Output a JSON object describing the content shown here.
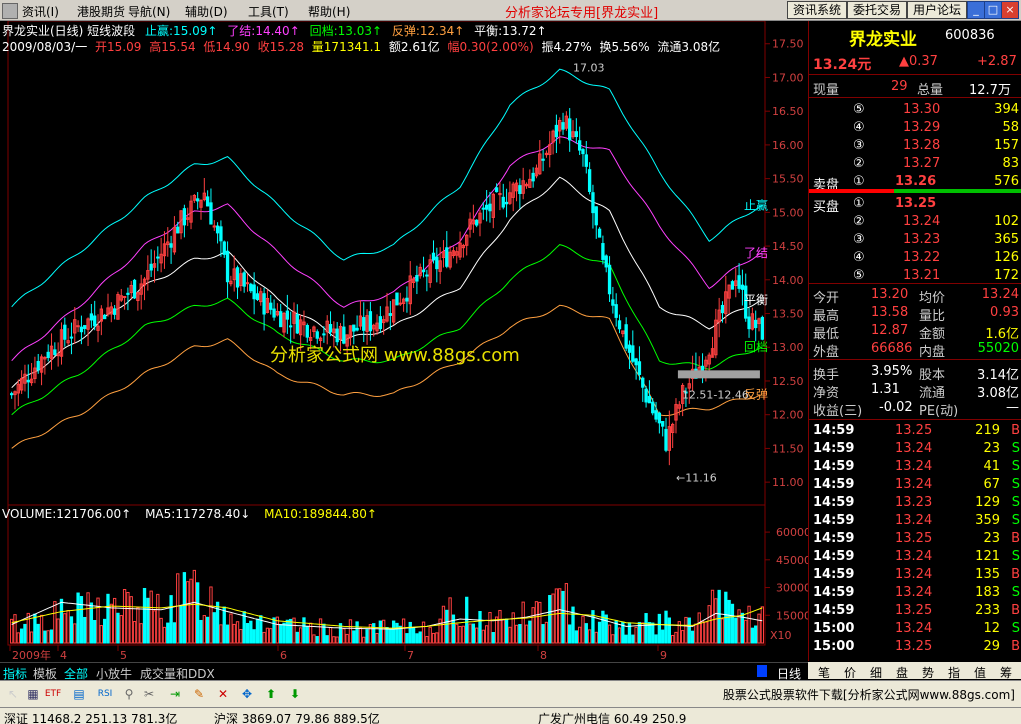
{
  "menubar": {
    "items": [
      "资讯(I)",
      "港股期货",
      "导航(N)",
      "辅助(D)",
      "工具(T)",
      "帮助(H)"
    ],
    "center_title": "分析家论坛专用[界龙实业]",
    "buttons": [
      "资讯系统",
      "委托交易",
      "用户论坛"
    ],
    "window_buttons": [
      "_",
      "□",
      "×"
    ]
  },
  "chart_header": {
    "line1": [
      {
        "text": "界龙实业(日线) 短线波段",
        "color": "#ffffff"
      },
      {
        "text": "止赢:15.09↑",
        "color": "#00ffff"
      },
      {
        "text": "了结:14.40↑",
        "color": "#ff40ff"
      },
      {
        "text": "回档:13.03↑",
        "color": "#00ff00"
      },
      {
        "text": "反弹:12.34↑",
        "color": "#ffa040"
      },
      {
        "text": "平衡:13.72↑",
        "color": "#ffffff"
      }
    ],
    "line2": [
      {
        "text": "2009/08/03/一",
        "color": "#ffffff"
      },
      {
        "text": "开15.09",
        "color": "#ff4040"
      },
      {
        "text": "高15.54",
        "color": "#ff4040"
      },
      {
        "text": "低14.90",
        "color": "#ff4040"
      },
      {
        "text": "收15.28",
        "color": "#ff4040"
      },
      {
        "text": "量171341.1",
        "color": "#ffff00"
      },
      {
        "text": "额2.61亿",
        "color": "#ffffff"
      },
      {
        "text": "幅0.30(2.00%)",
        "color": "#ff4040"
      },
      {
        "text": "振4.27%",
        "color": "#ffffff"
      },
      {
        "text": "换5.56%",
        "color": "#ffffff"
      },
      {
        "text": "流通3.08亿",
        "color": "#ffffff"
      }
    ],
    "watermark": "分析家公式网 www.88gs.com"
  },
  "chart_data": [
    {
      "type": "line",
      "name": "price-chart",
      "yaxis_ticks": [
        17.5,
        17.0,
        16.5,
        16.0,
        15.5,
        15.0,
        14.5,
        14.0,
        13.5,
        13.0,
        12.5,
        12.0,
        11.5,
        11.0
      ],
      "ylim": [
        10.75,
        17.6
      ],
      "x_ticks": [
        "2009年",
        "4",
        "5",
        "6",
        "7",
        "8",
        "9"
      ],
      "annotations": [
        {
          "text": "17.03",
          "x_index": 166,
          "y": 17.03
        },
        {
          "text": "11.16",
          "x_index": 197,
          "y": 11.16
        },
        {
          "text": "12.51-12.46",
          "x_index": 206,
          "y": 12.45
        }
      ],
      "band_labels": [
        "止赢",
        "了结",
        "平衡",
        "回档",
        "反弹"
      ],
      "series": [
        {
          "name": "止赢",
          "color": "#00ffff",
          "key": [
            [
              0,
              13.6
            ],
            [
              20,
              14.4
            ],
            [
              40,
              15.2
            ],
            [
              55,
              15.7
            ],
            [
              65,
              15.8
            ],
            [
              80,
              15.1
            ],
            [
              100,
              14.3
            ],
            [
              115,
              14.5
            ],
            [
              135,
              15.4
            ],
            [
              150,
              16.6
            ],
            [
              165,
              17.1
            ],
            [
              180,
              16.8
            ],
            [
              195,
              15.6
            ],
            [
              210,
              14.6
            ],
            [
              225,
              15.1
            ]
          ]
        },
        {
          "name": "了结",
          "color": "#ff40ff",
          "key": [
            [
              0,
              12.8
            ],
            [
              20,
              13.6
            ],
            [
              40,
              14.5
            ],
            [
              55,
              15.0
            ],
            [
              65,
              15.1
            ],
            [
              80,
              14.4
            ],
            [
              100,
              13.6
            ],
            [
              115,
              13.8
            ],
            [
              135,
              14.6
            ],
            [
              150,
              15.7
            ],
            [
              165,
              16.1
            ],
            [
              180,
              15.9
            ],
            [
              195,
              14.8
            ],
            [
              210,
              13.9
            ],
            [
              225,
              14.4
            ]
          ]
        },
        {
          "name": "平衡",
          "color": "#ffffff",
          "key": [
            [
              0,
              12.4
            ],
            [
              20,
              13.1
            ],
            [
              40,
              13.9
            ],
            [
              55,
              14.3
            ],
            [
              65,
              14.4
            ],
            [
              80,
              13.7
            ],
            [
              100,
              13.1
            ],
            [
              115,
              13.3
            ],
            [
              135,
              13.9
            ],
            [
              150,
              14.9
            ],
            [
              165,
              15.5
            ],
            [
              180,
              15.0
            ],
            [
              195,
              13.6
            ],
            [
              210,
              13.3
            ],
            [
              225,
              13.7
            ]
          ]
        },
        {
          "name": "回档",
          "color": "#00ff00",
          "key": [
            [
              0,
              12.0
            ],
            [
              20,
              12.6
            ],
            [
              40,
              13.3
            ],
            [
              55,
              13.6
            ],
            [
              65,
              13.7
            ],
            [
              80,
              13.2
            ],
            [
              100,
              12.8
            ],
            [
              115,
              12.8
            ],
            [
              135,
              13.3
            ],
            [
              150,
              14.0
            ],
            [
              165,
              14.5
            ],
            [
              180,
              14.2
            ],
            [
              195,
              12.8
            ],
            [
              210,
              12.7
            ],
            [
              225,
              13.0
            ]
          ]
        },
        {
          "name": "反弹",
          "color": "#ffa040",
          "key": [
            [
              0,
              11.5
            ],
            [
              20,
              12.0
            ],
            [
              40,
              12.6
            ],
            [
              55,
              13.0
            ],
            [
              65,
              13.1
            ],
            [
              80,
              12.6
            ],
            [
              100,
              12.3
            ],
            [
              115,
              12.3
            ],
            [
              135,
              12.8
            ],
            [
              150,
              13.3
            ],
            [
              165,
              13.6
            ],
            [
              180,
              13.4
            ],
            [
              195,
              12.0
            ],
            [
              210,
              12.1
            ],
            [
              225,
              12.3
            ]
          ]
        }
      ],
      "candle_key": [
        [
          0,
          12.3
        ],
        [
          10,
          12.9
        ],
        [
          20,
          13.3
        ],
        [
          30,
          13.6
        ],
        [
          40,
          14.0
        ],
        [
          50,
          14.8
        ],
        [
          58,
          15.3
        ],
        [
          65,
          14.1
        ],
        [
          72,
          13.8
        ],
        [
          80,
          13.5
        ],
        [
          90,
          13.3
        ],
        [
          100,
          13.2
        ],
        [
          110,
          13.4
        ],
        [
          120,
          13.9
        ],
        [
          130,
          14.3
        ],
        [
          140,
          14.9
        ],
        [
          150,
          15.3
        ],
        [
          158,
          15.6
        ],
        [
          166,
          16.4
        ],
        [
          172,
          15.8
        ],
        [
          178,
          14.2
        ],
        [
          184,
          13.2
        ],
        [
          190,
          12.4
        ],
        [
          197,
          11.6
        ],
        [
          202,
          12.3
        ],
        [
          208,
          12.8
        ],
        [
          214,
          13.5
        ],
        [
          218,
          14.1
        ],
        [
          222,
          13.4
        ],
        [
          226,
          13.24
        ]
      ],
      "candle_count": 227
    },
    {
      "type": "bar",
      "name": "volume-chart",
      "header": [
        {
          "text": "VOLUME:121706.00↑",
          "color": "#ffffff"
        },
        {
          "text": "MA5:117278.40↓",
          "color": "#ffffff"
        },
        {
          "text": "MA10:189844.80↑",
          "color": "#ffff00"
        }
      ],
      "yaxis_ticks": [
        60000,
        45000,
        30000,
        15000
      ],
      "ylim": [
        0,
        66000
      ],
      "unit_label": "X10",
      "vol_key": [
        [
          0,
          9000
        ],
        [
          15,
          14000
        ],
        [
          30,
          18000
        ],
        [
          45,
          17000
        ],
        [
          55,
          25000
        ],
        [
          65,
          16000
        ],
        [
          80,
          8000
        ],
        [
          100,
          7000
        ],
        [
          115,
          7000
        ],
        [
          125,
          8000
        ],
        [
          135,
          16000
        ],
        [
          145,
          11000
        ],
        [
          155,
          13000
        ],
        [
          165,
          20000
        ],
        [
          175,
          12000
        ],
        [
          185,
          8000
        ],
        [
          195,
          10000
        ],
        [
          205,
          8000
        ],
        [
          212,
          18000
        ],
        [
          220,
          14000
        ],
        [
          226,
          12000
        ]
      ],
      "ma5_key": [
        [
          0,
          10000
        ],
        [
          15,
          22000
        ],
        [
          30,
          19000
        ],
        [
          45,
          18000
        ],
        [
          55,
          22000
        ],
        [
          65,
          17000
        ],
        [
          80,
          10000
        ],
        [
          100,
          8000
        ],
        [
          115,
          7500
        ],
        [
          125,
          9000
        ],
        [
          135,
          13000
        ],
        [
          145,
          12000
        ],
        [
          155,
          14000
        ],
        [
          165,
          18000
        ],
        [
          175,
          14000
        ],
        [
          185,
          9000
        ],
        [
          195,
          10000
        ],
        [
          205,
          9000
        ],
        [
          212,
          16000
        ],
        [
          220,
          14000
        ],
        [
          226,
          12000
        ]
      ],
      "ma10_key": [
        [
          0,
          11000
        ],
        [
          15,
          17000
        ],
        [
          30,
          20000
        ],
        [
          45,
          19000
        ],
        [
          55,
          21000
        ],
        [
          65,
          19000
        ],
        [
          80,
          12000
        ],
        [
          100,
          9000
        ],
        [
          115,
          8000
        ],
        [
          125,
          9000
        ],
        [
          135,
          11000
        ],
        [
          145,
          12500
        ],
        [
          155,
          13500
        ],
        [
          165,
          16000
        ],
        [
          175,
          15000
        ],
        [
          185,
          11000
        ],
        [
          195,
          10000
        ],
        [
          205,
          9500
        ],
        [
          212,
          13000
        ],
        [
          220,
          15000
        ],
        [
          226,
          19000
        ]
      ]
    }
  ],
  "right_panel": {
    "name": "界龙实业",
    "code": "600836",
    "price": "13.24元",
    "change": "▲0.37",
    "change2": "+2.87",
    "xianliang_label": "现量",
    "xianliang": "29",
    "zongliang_label": "总量",
    "zongliang": "12.7万",
    "sell_rows": [
      {
        "idx": "⑤",
        "price": "13.30",
        "vol": "394"
      },
      {
        "idx": "④",
        "price": "13.29",
        "vol": "58"
      },
      {
        "idx": "③",
        "price": "13.28",
        "vol": "157"
      },
      {
        "idx": "②",
        "price": "13.27",
        "vol": "83"
      },
      {
        "idx": "①",
        "price": "13.26",
        "vol": "576",
        "label": "卖盘"
      }
    ],
    "buy_rows": [
      {
        "idx": "①",
        "price": "13.25",
        "vol": "",
        "label": "买盘"
      },
      {
        "idx": "②",
        "price": "13.24",
        "vol": "102"
      },
      {
        "idx": "③",
        "price": "13.23",
        "vol": "365"
      },
      {
        "idx": "④",
        "price": "13.22",
        "vol": "126"
      },
      {
        "idx": "⑤",
        "price": "13.21",
        "vol": "172"
      }
    ],
    "stats": [
      {
        "l1": "今开",
        "v1": "13.20",
        "l2": "均价",
        "v2": "13.24"
      },
      {
        "l1": "最高",
        "v1": "13.58",
        "l2": "量比",
        "v2": "0.93"
      },
      {
        "l1": "最低",
        "v1": "12.87",
        "l2": "金额",
        "v2": "1.6亿"
      },
      {
        "l1": "外盘",
        "v1": "66686",
        "l2": "内盘",
        "v2": "55020"
      }
    ],
    "stats2": [
      {
        "l1": "换手",
        "v1": "3.95%",
        "l2": "股本",
        "v2": "3.14亿"
      },
      {
        "l1": "净资",
        "v1": "1.31",
        "l2": "流通",
        "v2": "3.08亿"
      },
      {
        "l1": "收益(三)",
        "v1": "-0.02",
        "l2": "PE(动)",
        "v2": "—"
      }
    ],
    "ticks": [
      {
        "t": "14:59",
        "p": "13.25",
        "v": "219",
        "s": "B"
      },
      {
        "t": "14:59",
        "p": "13.24",
        "v": "23",
        "s": "S"
      },
      {
        "t": "14:59",
        "p": "13.24",
        "v": "41",
        "s": "S"
      },
      {
        "t": "14:59",
        "p": "13.24",
        "v": "67",
        "s": "S"
      },
      {
        "t": "14:59",
        "p": "13.23",
        "v": "129",
        "s": "S"
      },
      {
        "t": "14:59",
        "p": "13.24",
        "v": "359",
        "s": "S"
      },
      {
        "t": "14:59",
        "p": "13.25",
        "v": "23",
        "s": "B"
      },
      {
        "t": "14:59",
        "p": "13.24",
        "v": "121",
        "s": "S"
      },
      {
        "t": "14:59",
        "p": "13.24",
        "v": "135",
        "s": "B"
      },
      {
        "t": "14:59",
        "p": "13.24",
        "v": "183",
        "s": "S"
      },
      {
        "t": "14:59",
        "p": "13.25",
        "v": "233",
        "s": "B"
      },
      {
        "t": "15:00",
        "p": "13.24",
        "v": "12",
        "s": "S"
      },
      {
        "t": "15:00",
        "p": "13.25",
        "v": "29",
        "s": "B"
      }
    ]
  },
  "tabs": [
    "指标",
    "模板",
    "全部",
    "小放牛",
    "成交量和DDX"
  ],
  "period_label": "日线",
  "right_tabs": [
    "笔",
    "价",
    "细",
    "盘",
    "势",
    "指",
    "值",
    "筹"
  ],
  "toolbar_icons": [
    "cursor-icon",
    "grid-icon",
    "etf-icon",
    "chart-icon",
    "rsi-icon",
    "link-icon",
    "tool-icon",
    "export-icon",
    "pencil-icon",
    "close-icon",
    "move-icon",
    "arrow-up-icon",
    "arrow-down-icon"
  ],
  "ad_text": "股票公式股票软件下载[分析家公式网www.88gs.com]",
  "status": {
    "left": "深证 11468.2  251.13  781.3亿",
    "mid": "沪深 3869.07  79.86  889.5亿",
    "right": "广发广州电信 60.49  250.9"
  }
}
